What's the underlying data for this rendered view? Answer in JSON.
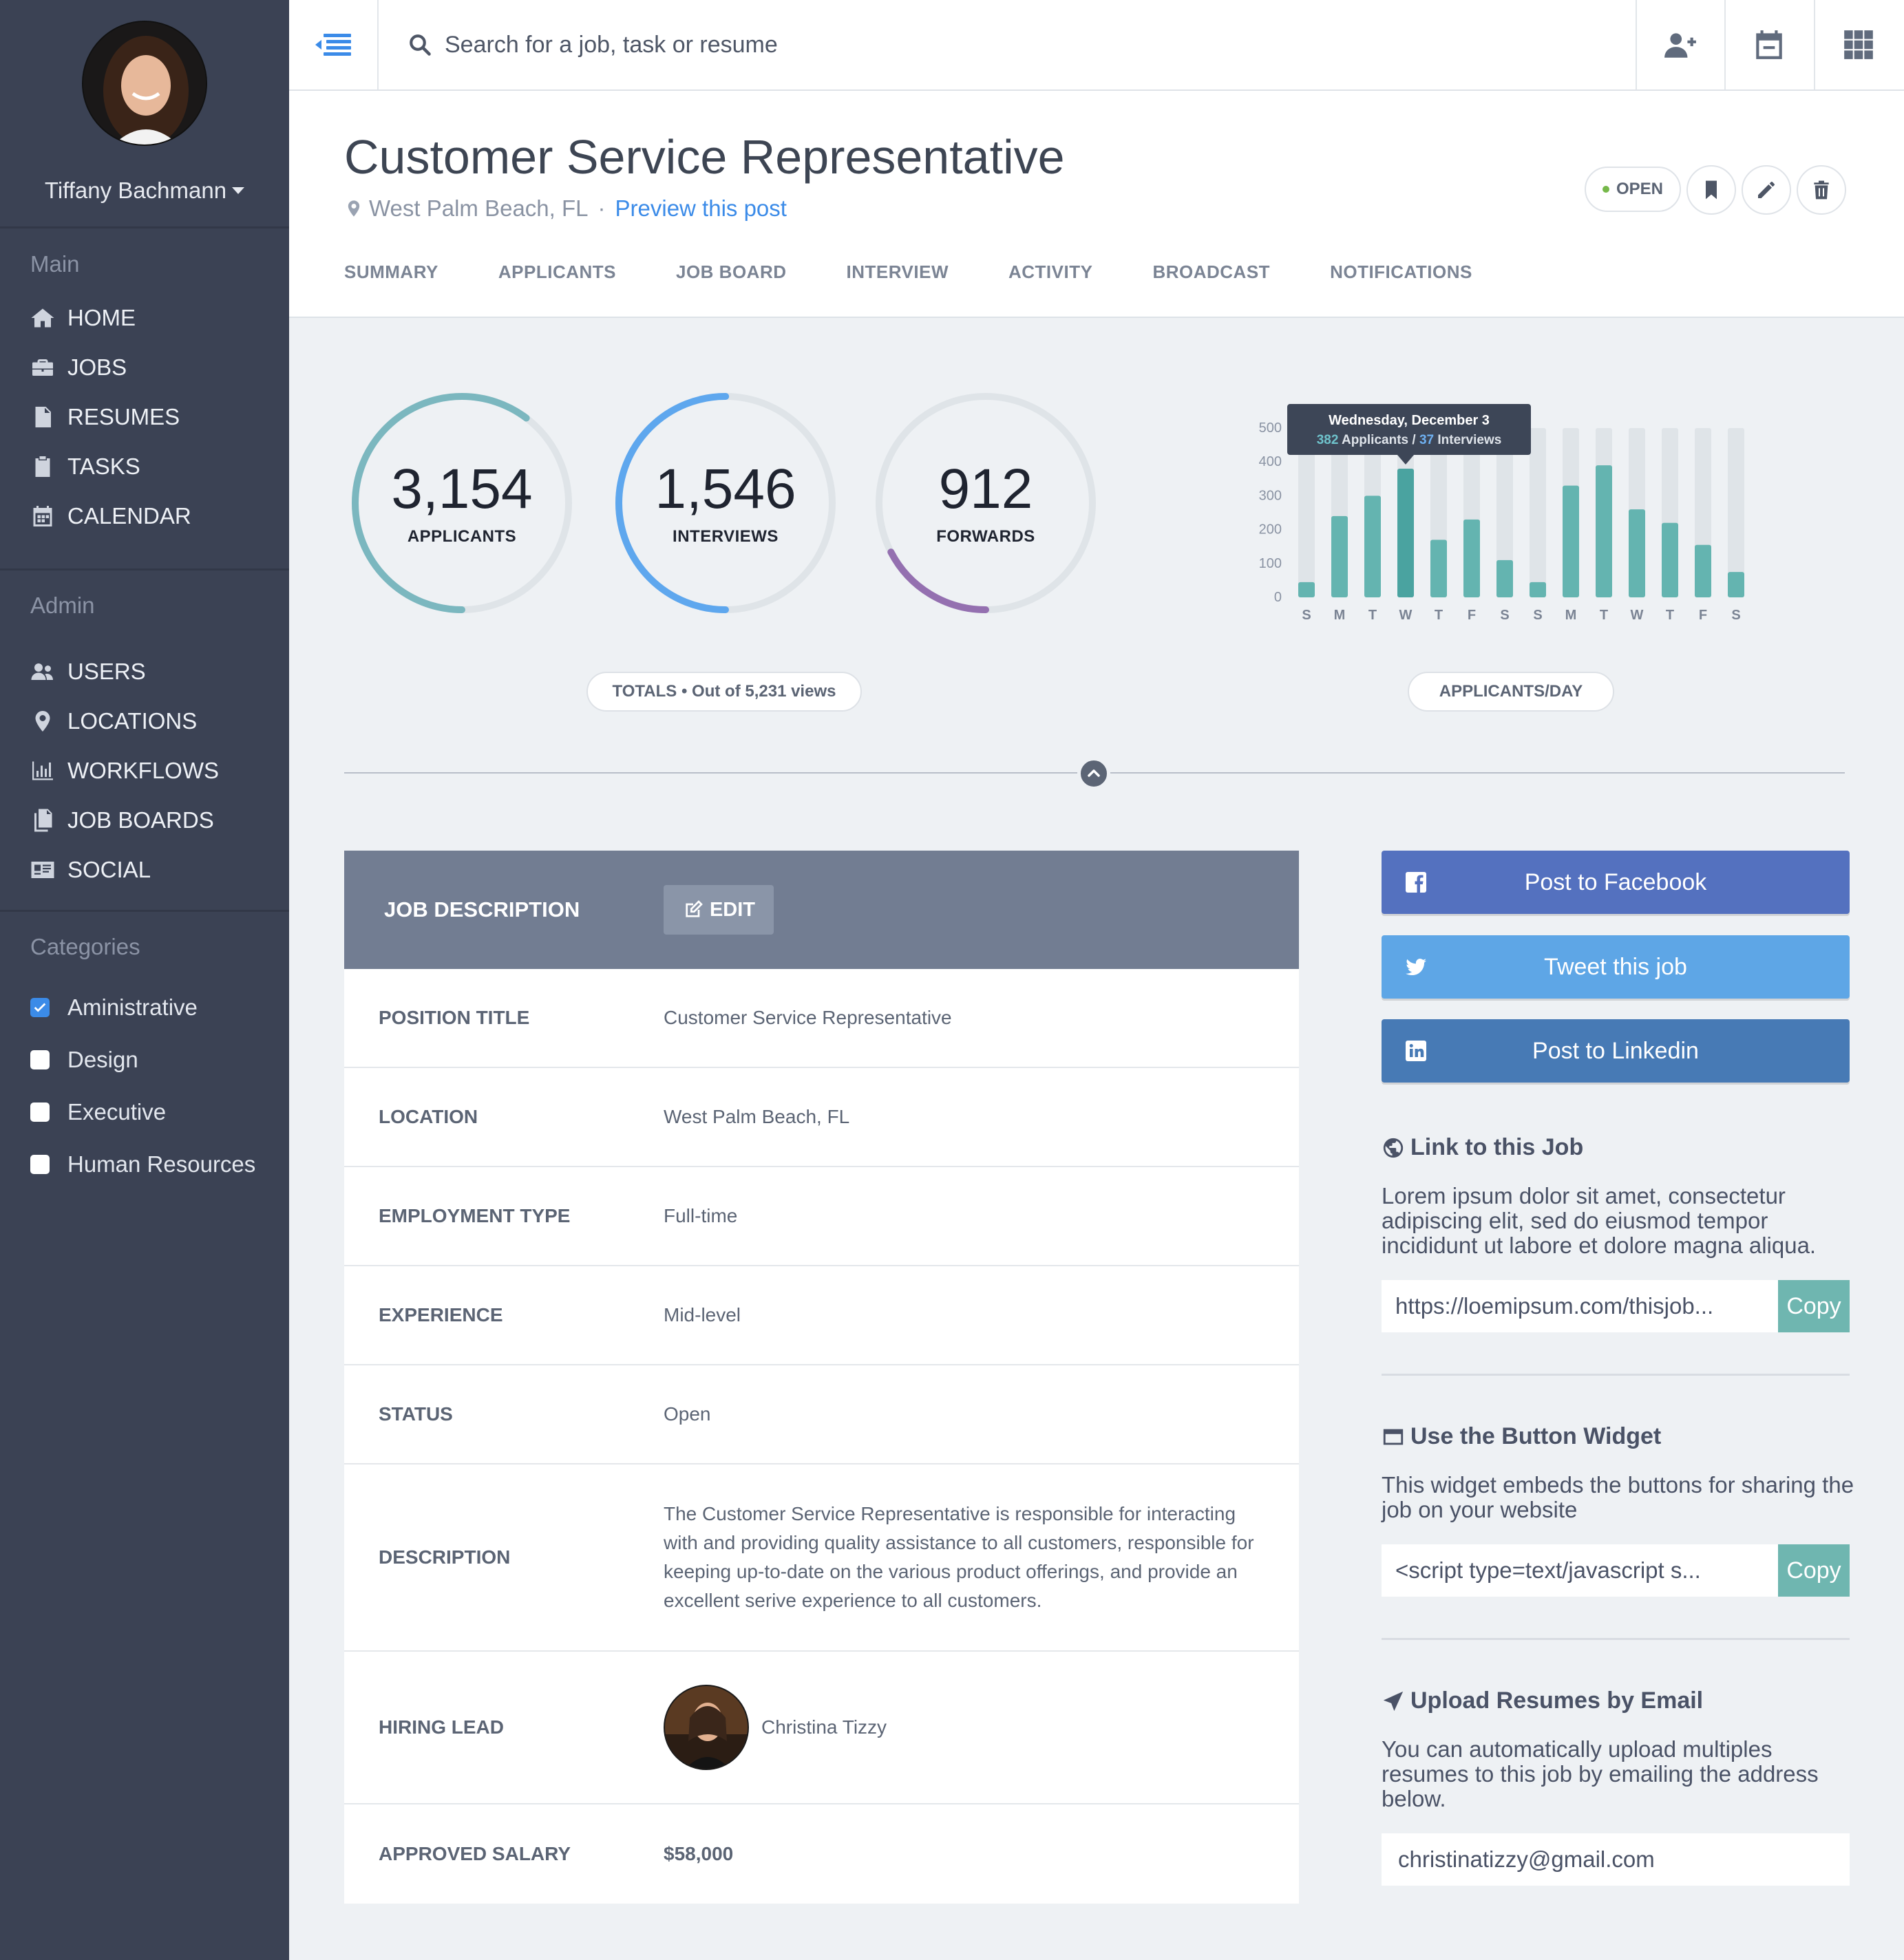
{
  "user": {
    "name": "Tiffany Bachmann"
  },
  "sidebar": {
    "main_heading": "Main",
    "main_items": [
      {
        "label": "HOME",
        "icon": "home-icon"
      },
      {
        "label": "JOBS",
        "icon": "briefcase-icon"
      },
      {
        "label": "RESUMES",
        "icon": "document-icon"
      },
      {
        "label": "TASKS",
        "icon": "clipboard-icon"
      },
      {
        "label": "CALENDAR",
        "icon": "calendar-icon"
      }
    ],
    "admin_heading": "Admin",
    "admin_items": [
      {
        "label": "USERS",
        "icon": "users-icon"
      },
      {
        "label": "LOCATIONS",
        "icon": "map-pin-icon"
      },
      {
        "label": "WORKFLOWS",
        "icon": "bar-chart-icon"
      },
      {
        "label": "JOB BOARDS",
        "icon": "files-icon"
      },
      {
        "label": "SOCIAL",
        "icon": "id-card-icon"
      }
    ],
    "categories_heading": "Categories",
    "categories": [
      {
        "label": "Aministrative",
        "checked": true
      },
      {
        "label": "Design",
        "checked": false
      },
      {
        "label": "Executive",
        "checked": false
      },
      {
        "label": "Human Resources",
        "checked": false
      }
    ]
  },
  "search": {
    "placeholder": "Search for a job, task or resume"
  },
  "header": {
    "title": "Customer Service Representative",
    "location": "West Palm Beach, FL",
    "separator": "·",
    "preview_link": "Preview this post",
    "status_badge": "OPEN",
    "tabs": [
      "SUMMARY",
      "APPLICANTS",
      "JOB BOARD",
      "INTERVIEW",
      "ACTIVITY",
      "BROADCAST",
      "NOTIFICATIONS"
    ]
  },
  "stats": {
    "rings": [
      {
        "value": "3,154",
        "label": "APPLICANTS",
        "color": "#7bb7bf",
        "fraction": 0.603
      },
      {
        "value": "1,546",
        "label": "INTERVIEWS",
        "color": "#5ea7ee",
        "fraction": 0.5
      },
      {
        "value": "912",
        "label": "FORWARDS",
        "color": "#9470b0",
        "fraction": 0.174
      }
    ],
    "totals_prefix": "TOTALS",
    "totals_bullet": "•",
    "totals_suffix": "Out of 5,231 views",
    "chart_pill": "APPLICANTS/DAY"
  },
  "chart_data": {
    "type": "bar",
    "categories": [
      "S",
      "M",
      "T",
      "W",
      "T",
      "F",
      "S",
      "S",
      "M",
      "T",
      "W",
      "T",
      "F",
      "S"
    ],
    "values": [
      45,
      240,
      300,
      380,
      170,
      230,
      110,
      45,
      330,
      390,
      260,
      220,
      155,
      75
    ],
    "max_values": [
      500,
      500,
      500,
      500,
      500,
      500,
      500,
      500,
      500,
      500,
      500,
      500,
      500,
      500
    ],
    "ylim": [
      0,
      500
    ],
    "yticks": [
      0,
      100,
      200,
      300,
      400,
      500
    ],
    "bar_color": "#64b4b0",
    "track_color": "#dfe4e8",
    "highlight_index": 3,
    "highlight_color": "#4aa3a0",
    "tooltip": {
      "title": "Wednesday, December 3",
      "applicants": "382",
      "applicants_label": "Applicants",
      "slash": "/",
      "interviews": "37",
      "interviews_label": "Interviews"
    }
  },
  "job_description": {
    "header_title": "JOB DESCRIPTION",
    "edit_label": "EDIT",
    "rows": [
      {
        "label": "POSITION TITLE",
        "value": "Customer Service Representative"
      },
      {
        "label": "LOCATION",
        "value": "West Palm Beach, FL"
      },
      {
        "label": "EMPLOYMENT TYPE",
        "value": "Full-time"
      },
      {
        "label": "EXPERIENCE",
        "value": "Mid-level"
      },
      {
        "label": "STATUS",
        "value": "Open"
      },
      {
        "label": "DESCRIPTION",
        "value": "The Customer Service Representative is responsible for interacting with and providing quality assistance to all customers, responsible for keeping up-to-date on the various product offerings, and provide an excellent serive experience to all customers."
      },
      {
        "label": "HIRING LEAD",
        "value": "Christina Tizzy"
      },
      {
        "label": "APPROVED SALARY",
        "value": "$58,000"
      }
    ]
  },
  "share": {
    "facebook": {
      "label": "Post to Facebook",
      "color": "#5471bf"
    },
    "twitter": {
      "label": "Tweet this job",
      "color": "#5ea6e6"
    },
    "linkedin": {
      "label": "Post to Linkedin",
      "color": "#477ab5"
    }
  },
  "link_section": {
    "title": "Link to this Job",
    "text": "Lorem ipsum dolor sit amet, consectetur adipiscing elit, sed do eiusmod tempor incididunt ut labore et dolore magna aliqua.",
    "value": "https://loemipsum.com/thisjob...",
    "copy_label": "Copy"
  },
  "widget_section": {
    "title": "Use the Button Widget",
    "text": "This widget embeds the buttons for sharing the job on your website",
    "value": "<script type=text/javascript s...",
    "copy_label": "Copy"
  },
  "email_section": {
    "title": "Upload Resumes by Email",
    "text": "You can automatically upload multiples resumes to this job by emailing the address below.",
    "value": "christinatizzy@gmail.com"
  }
}
